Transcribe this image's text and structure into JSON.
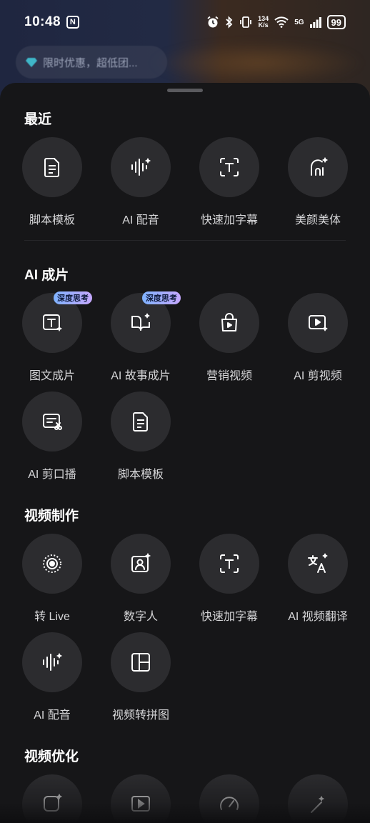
{
  "status_bar": {
    "time": "10:48",
    "nfc_label": "N",
    "speed_top": "134",
    "speed_bottom": "K/s",
    "network": "5G",
    "battery": "99"
  },
  "promo": {
    "text": "限时优惠，超低团..."
  },
  "sections": {
    "recent": {
      "title": "最近",
      "items": [
        {
          "label": "脚本模板",
          "icon": "document-icon"
        },
        {
          "label": "AI 配音",
          "icon": "voice-wave-icon"
        },
        {
          "label": "快速加字幕",
          "icon": "text-frame-icon"
        },
        {
          "label": "美颜美体",
          "icon": "beauty-face-icon"
        }
      ]
    },
    "ai_film": {
      "title": "AI 成片",
      "badge": "深度思考",
      "items": [
        {
          "label": "图文成片",
          "icon": "text-image-sparkle-icon",
          "badge": "深度思考"
        },
        {
          "label": "AI 故事成片",
          "icon": "book-sparkle-icon",
          "badge": "深度思考"
        },
        {
          "label": "营销视频",
          "icon": "shopping-bag-play-icon"
        },
        {
          "label": "AI 剪视频",
          "icon": "video-sparkle-icon"
        },
        {
          "label": "AI 剪口播",
          "icon": "script-scissors-icon"
        },
        {
          "label": "脚本模板",
          "icon": "document-icon"
        }
      ]
    },
    "video_make": {
      "title": "视频制作",
      "items": [
        {
          "label": "转 Live",
          "icon": "live-circle-icon"
        },
        {
          "label": "数字人",
          "icon": "digital-human-icon"
        },
        {
          "label": "快速加字幕",
          "icon": "text-frame-icon"
        },
        {
          "label": "AI 视频翻译",
          "icon": "translate-icon"
        },
        {
          "label": "AI 配音",
          "icon": "voice-wave-icon"
        },
        {
          "label": "视频转拼图",
          "icon": "collage-icon"
        }
      ]
    },
    "video_optimize": {
      "title": "视频优化",
      "items": [
        {
          "icon": "face-sparkle-icon"
        },
        {
          "icon": "play-frame-icon"
        },
        {
          "icon": "speed-gauge-icon"
        },
        {
          "icon": "magic-wand-icon"
        }
      ]
    }
  }
}
